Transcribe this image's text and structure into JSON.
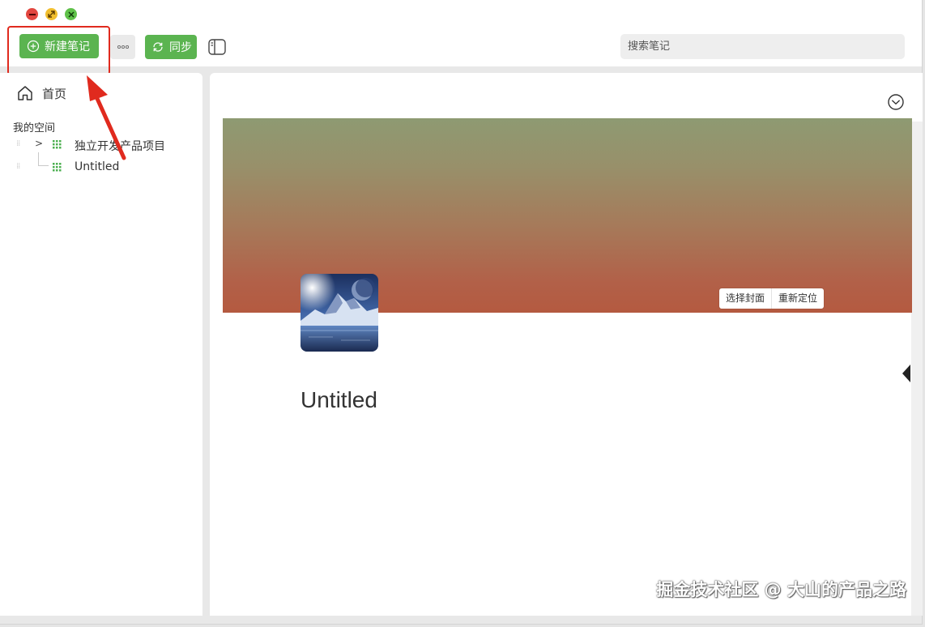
{
  "toolbar": {
    "new_note_label": "新建笔记",
    "sync_label": "同步",
    "search_placeholder": "搜索笔记"
  },
  "sidebar": {
    "home_label": "首页",
    "section_title": "我的空间",
    "items": [
      {
        "label": "独立开发产品项目",
        "icon": "grid-icon",
        "expandable": true
      },
      {
        "label": "Untitled",
        "icon": "grid-icon",
        "expandable": false
      }
    ]
  },
  "main": {
    "cover_buttons": {
      "choose_cover": "选择封面",
      "reposition": "重新定位"
    },
    "page_title": "Untitled"
  },
  "watermark": "掘金技术社区 @ 大山的产品之路",
  "colors": {
    "accent_green": "#5bb450",
    "annotation_red": "#e02a1e"
  }
}
